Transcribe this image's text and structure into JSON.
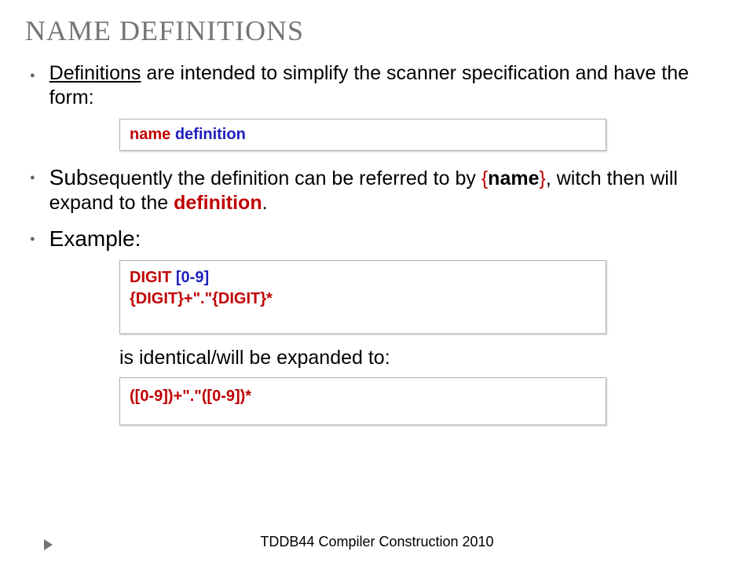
{
  "title": "NAME DEFINITIONS",
  "bullet1": {
    "underlined": "Definitions",
    "rest": " are intended to simplify the scanner specification and have the form:"
  },
  "codebox1": {
    "name": "name",
    "gap": "     ",
    "definition": "definition"
  },
  "bullet2": {
    "sub": "Sub",
    "part1": "sequently the definition can be referred to by ",
    "brace_open": "{",
    "name_word": "name",
    "brace_close": "}",
    "part2": ", witch then will expand to the ",
    "definition_word": "definition",
    "part3": "."
  },
  "bullet3": "Example:",
  "codebox2": {
    "line1a": "DIGIT   ",
    "line1b": "[0-9]",
    "line2": "{DIGIT}+\".\"{DIGIT}*"
  },
  "expanded_text": "is identical/will be expanded to:",
  "codebox3": "([0-9])+\".\"([0-9])*",
  "footer": "TDDB44 Compiler Construction 2010"
}
